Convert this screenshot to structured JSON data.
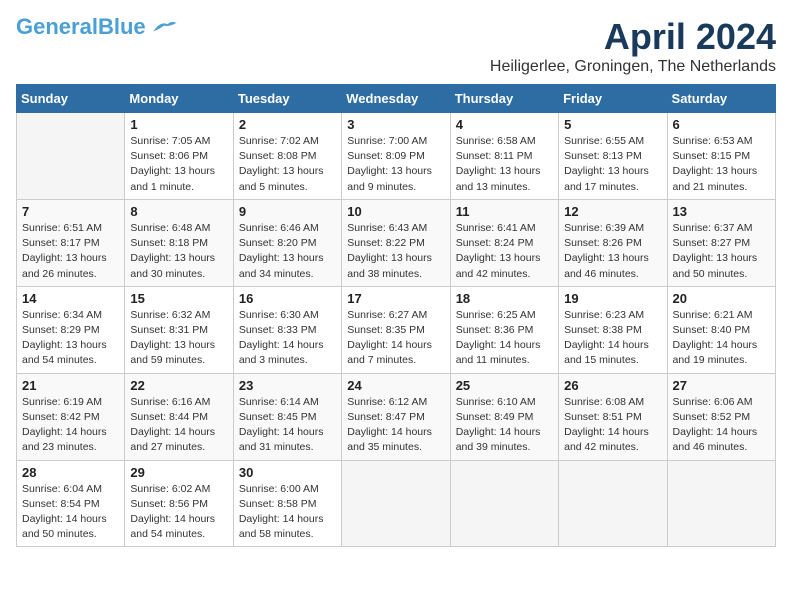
{
  "logo": {
    "general": "General",
    "blue": "Blue"
  },
  "title": "April 2024",
  "subtitle": "Heiligerlee, Groningen, The Netherlands",
  "days_of_week": [
    "Sunday",
    "Monday",
    "Tuesday",
    "Wednesday",
    "Thursday",
    "Friday",
    "Saturday"
  ],
  "weeks": [
    [
      {
        "day": "",
        "sunrise": "",
        "sunset": "",
        "daylight": ""
      },
      {
        "day": "1",
        "sunrise": "Sunrise: 7:05 AM",
        "sunset": "Sunset: 8:06 PM",
        "daylight": "Daylight: 13 hours and 1 minute."
      },
      {
        "day": "2",
        "sunrise": "Sunrise: 7:02 AM",
        "sunset": "Sunset: 8:08 PM",
        "daylight": "Daylight: 13 hours and 5 minutes."
      },
      {
        "day": "3",
        "sunrise": "Sunrise: 7:00 AM",
        "sunset": "Sunset: 8:09 PM",
        "daylight": "Daylight: 13 hours and 9 minutes."
      },
      {
        "day": "4",
        "sunrise": "Sunrise: 6:58 AM",
        "sunset": "Sunset: 8:11 PM",
        "daylight": "Daylight: 13 hours and 13 minutes."
      },
      {
        "day": "5",
        "sunrise": "Sunrise: 6:55 AM",
        "sunset": "Sunset: 8:13 PM",
        "daylight": "Daylight: 13 hours and 17 minutes."
      },
      {
        "day": "6",
        "sunrise": "Sunrise: 6:53 AM",
        "sunset": "Sunset: 8:15 PM",
        "daylight": "Daylight: 13 hours and 21 minutes."
      }
    ],
    [
      {
        "day": "7",
        "sunrise": "Sunrise: 6:51 AM",
        "sunset": "Sunset: 8:17 PM",
        "daylight": "Daylight: 13 hours and 26 minutes."
      },
      {
        "day": "8",
        "sunrise": "Sunrise: 6:48 AM",
        "sunset": "Sunset: 8:18 PM",
        "daylight": "Daylight: 13 hours and 30 minutes."
      },
      {
        "day": "9",
        "sunrise": "Sunrise: 6:46 AM",
        "sunset": "Sunset: 8:20 PM",
        "daylight": "Daylight: 13 hours and 34 minutes."
      },
      {
        "day": "10",
        "sunrise": "Sunrise: 6:43 AM",
        "sunset": "Sunset: 8:22 PM",
        "daylight": "Daylight: 13 hours and 38 minutes."
      },
      {
        "day": "11",
        "sunrise": "Sunrise: 6:41 AM",
        "sunset": "Sunset: 8:24 PM",
        "daylight": "Daylight: 13 hours and 42 minutes."
      },
      {
        "day": "12",
        "sunrise": "Sunrise: 6:39 AM",
        "sunset": "Sunset: 8:26 PM",
        "daylight": "Daylight: 13 hours and 46 minutes."
      },
      {
        "day": "13",
        "sunrise": "Sunrise: 6:37 AM",
        "sunset": "Sunset: 8:27 PM",
        "daylight": "Daylight: 13 hours and 50 minutes."
      }
    ],
    [
      {
        "day": "14",
        "sunrise": "Sunrise: 6:34 AM",
        "sunset": "Sunset: 8:29 PM",
        "daylight": "Daylight: 13 hours and 54 minutes."
      },
      {
        "day": "15",
        "sunrise": "Sunrise: 6:32 AM",
        "sunset": "Sunset: 8:31 PM",
        "daylight": "Daylight: 13 hours and 59 minutes."
      },
      {
        "day": "16",
        "sunrise": "Sunrise: 6:30 AM",
        "sunset": "Sunset: 8:33 PM",
        "daylight": "Daylight: 14 hours and 3 minutes."
      },
      {
        "day": "17",
        "sunrise": "Sunrise: 6:27 AM",
        "sunset": "Sunset: 8:35 PM",
        "daylight": "Daylight: 14 hours and 7 minutes."
      },
      {
        "day": "18",
        "sunrise": "Sunrise: 6:25 AM",
        "sunset": "Sunset: 8:36 PM",
        "daylight": "Daylight: 14 hours and 11 minutes."
      },
      {
        "day": "19",
        "sunrise": "Sunrise: 6:23 AM",
        "sunset": "Sunset: 8:38 PM",
        "daylight": "Daylight: 14 hours and 15 minutes."
      },
      {
        "day": "20",
        "sunrise": "Sunrise: 6:21 AM",
        "sunset": "Sunset: 8:40 PM",
        "daylight": "Daylight: 14 hours and 19 minutes."
      }
    ],
    [
      {
        "day": "21",
        "sunrise": "Sunrise: 6:19 AM",
        "sunset": "Sunset: 8:42 PM",
        "daylight": "Daylight: 14 hours and 23 minutes."
      },
      {
        "day": "22",
        "sunrise": "Sunrise: 6:16 AM",
        "sunset": "Sunset: 8:44 PM",
        "daylight": "Daylight: 14 hours and 27 minutes."
      },
      {
        "day": "23",
        "sunrise": "Sunrise: 6:14 AM",
        "sunset": "Sunset: 8:45 PM",
        "daylight": "Daylight: 14 hours and 31 minutes."
      },
      {
        "day": "24",
        "sunrise": "Sunrise: 6:12 AM",
        "sunset": "Sunset: 8:47 PM",
        "daylight": "Daylight: 14 hours and 35 minutes."
      },
      {
        "day": "25",
        "sunrise": "Sunrise: 6:10 AM",
        "sunset": "Sunset: 8:49 PM",
        "daylight": "Daylight: 14 hours and 39 minutes."
      },
      {
        "day": "26",
        "sunrise": "Sunrise: 6:08 AM",
        "sunset": "Sunset: 8:51 PM",
        "daylight": "Daylight: 14 hours and 42 minutes."
      },
      {
        "day": "27",
        "sunrise": "Sunrise: 6:06 AM",
        "sunset": "Sunset: 8:52 PM",
        "daylight": "Daylight: 14 hours and 46 minutes."
      }
    ],
    [
      {
        "day": "28",
        "sunrise": "Sunrise: 6:04 AM",
        "sunset": "Sunset: 8:54 PM",
        "daylight": "Daylight: 14 hours and 50 minutes."
      },
      {
        "day": "29",
        "sunrise": "Sunrise: 6:02 AM",
        "sunset": "Sunset: 8:56 PM",
        "daylight": "Daylight: 14 hours and 54 minutes."
      },
      {
        "day": "30",
        "sunrise": "Sunrise: 6:00 AM",
        "sunset": "Sunset: 8:58 PM",
        "daylight": "Daylight: 14 hours and 58 minutes."
      },
      {
        "day": "",
        "sunrise": "",
        "sunset": "",
        "daylight": ""
      },
      {
        "day": "",
        "sunrise": "",
        "sunset": "",
        "daylight": ""
      },
      {
        "day": "",
        "sunrise": "",
        "sunset": "",
        "daylight": ""
      },
      {
        "day": "",
        "sunrise": "",
        "sunset": "",
        "daylight": ""
      }
    ]
  ]
}
